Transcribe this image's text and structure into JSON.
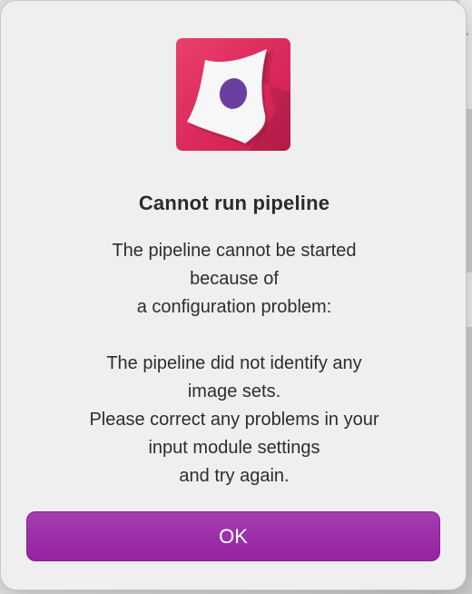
{
  "dialog": {
    "title": "Cannot run pipeline",
    "message_lines": [
      "The pipeline cannot be started",
      "because of",
      "a configuration problem:",
      "",
      "The pipeline did not identify any",
      "image sets.",
      "Please correct any problems in your",
      "input module settings",
      "and try again."
    ],
    "ok_label": "OK",
    "icon": "app-icon"
  },
  "colors": {
    "dialog_bg": "#f0efef",
    "icon_bg": "#e03565",
    "icon_dot": "#6b3fa0",
    "button_bg": "#9b2aa8",
    "button_text": "#ffffff"
  }
}
